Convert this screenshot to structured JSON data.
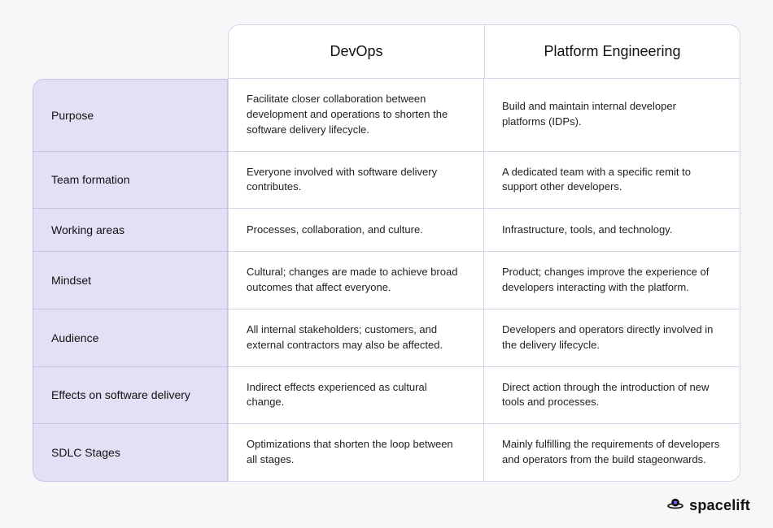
{
  "columns": {
    "devops": "DevOps",
    "pe": "Platform Engineering"
  },
  "rows": [
    {
      "label": "Purpose",
      "devops": "Facilitate closer collaboration between development and operations to shorten the software delivery lifecycle.",
      "pe": "Build and maintain internal developer platforms (IDPs)."
    },
    {
      "label": "Team formation",
      "devops": "Everyone involved with software delivery contributes.",
      "pe": "A dedicated team with a specific remit to support other developers."
    },
    {
      "label": "Working areas",
      "devops": "Processes, collaboration, and culture.",
      "pe": "Infrastructure, tools, and technology."
    },
    {
      "label": "Mindset",
      "devops": "Cultural; changes are made to achieve broad outcomes that affect everyone.",
      "pe": "Product; changes improve the experience of developers interacting with the platform."
    },
    {
      "label": "Audience",
      "devops": "All internal stakeholders; customers, and external contractors may also be affected.",
      "pe": "Developers and operators directly involved in the delivery lifecycle."
    },
    {
      "label": "Effects on software delivery",
      "devops": "Indirect effects experienced as cultural change.",
      "pe": "Direct action through the introduction of new tools and processes."
    },
    {
      "label": "SDLC Stages",
      "devops": "Optimizations that shorten the loop between all stages.",
      "pe": "Mainly fulfilling the requirements of developers and operators from the build stageonwards."
    }
  ],
  "brand": {
    "name": "spacelift"
  }
}
